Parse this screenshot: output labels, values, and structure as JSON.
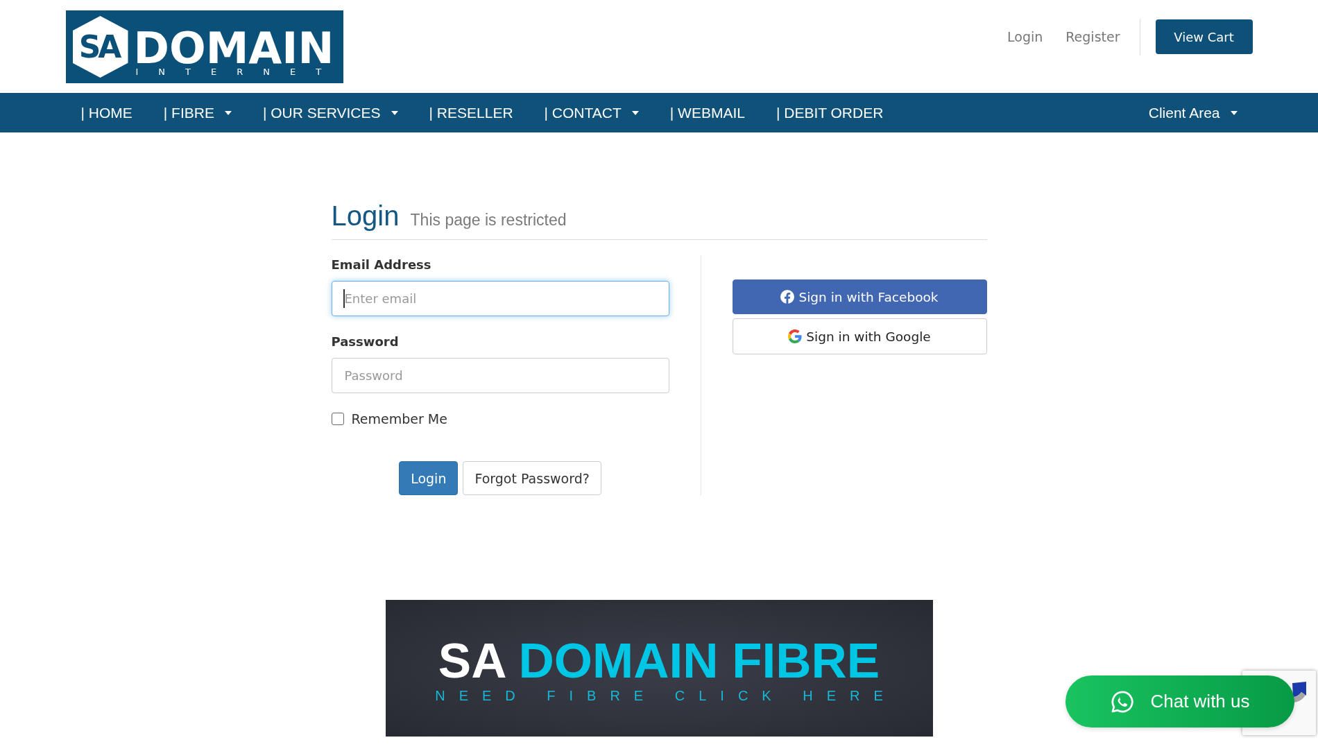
{
  "header": {
    "logo": {
      "mark": "SA",
      "wordmark": "DOMAIN",
      "tagline": "INTERNET"
    },
    "links": [
      {
        "label": "Login"
      },
      {
        "label": "Register"
      }
    ],
    "cart_button": "View Cart"
  },
  "nav": {
    "items": [
      {
        "label": "| HOME",
        "has_menu": false
      },
      {
        "label": "| FIBRE",
        "has_menu": true
      },
      {
        "label": "| OUR SERVICES",
        "has_menu": true
      },
      {
        "label": "| RESELLER",
        "has_menu": false
      },
      {
        "label": "| CONTACT",
        "has_menu": true
      },
      {
        "label": "| WEBMAIL",
        "has_menu": false
      },
      {
        "label": "| DEBIT ORDER",
        "has_menu": false
      }
    ],
    "account_menu": {
      "label": "Client Area",
      "has_menu": true
    }
  },
  "login": {
    "title": "Login",
    "subtitle": "This page is restricted",
    "fields": [
      {
        "label": "Email Address",
        "placeholder": "Enter email",
        "focused": true
      },
      {
        "label": "Password",
        "placeholder": "Password",
        "focused": false
      }
    ],
    "remember": {
      "label": "Remember Me",
      "checked": false
    },
    "buttons": [
      {
        "label": "Login",
        "kind": "primary"
      },
      {
        "label": "Forgot Password?",
        "kind": "secondary"
      }
    ],
    "social": [
      {
        "label": "Sign in with Facebook",
        "kind": "facebook"
      },
      {
        "label": "Sign in with Google",
        "kind": "google"
      }
    ]
  },
  "banner": {
    "title_lead": "SA",
    "title_highlight": "DOMAIN FIBRE",
    "tagline": "NEED FIBRE CLICK HERE"
  },
  "chat_button": {
    "label": "Chat with us"
  }
}
